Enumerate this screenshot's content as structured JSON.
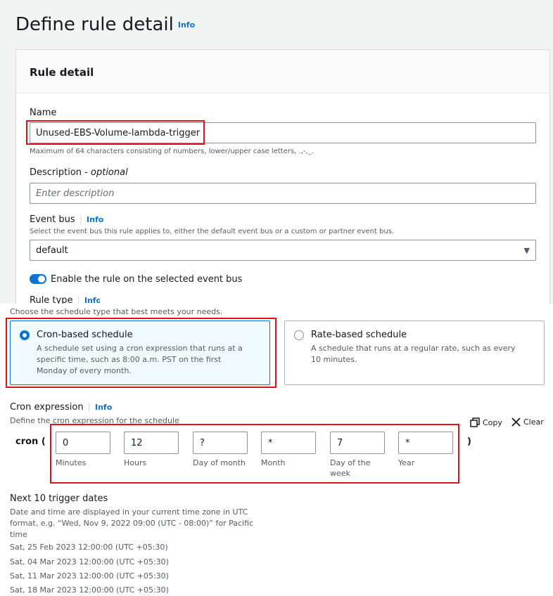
{
  "page": {
    "title": "Define rule detail",
    "info_label": "Info"
  },
  "rule_detail": {
    "section_title": "Rule detail",
    "name": {
      "label": "Name",
      "value": "Unused-EBS-Volume-lambda-trigger",
      "hint": "Maximum of 64 characters consisting of numbers, lower/upper case letters, .,-,_."
    },
    "description": {
      "label": "Description",
      "optional": "optional",
      "placeholder": "Enter description"
    },
    "event_bus": {
      "label": "Event bus",
      "info": "Info",
      "hint": "Select the event bus this rule applies to, either the default event bus or a custom or partner event bus.",
      "value": "default"
    },
    "enable_toggle": {
      "label": "Enable the rule on the selected event bus",
      "on": true
    },
    "rule_type": {
      "label": "Rule type",
      "info": "Info"
    }
  },
  "schedule": {
    "hint": "Choose the schedule type that best meets your needs.",
    "options": [
      {
        "title": "Cron-based schedule",
        "description": "A schedule set using a cron expression that runs at a specific time, such as 8:00 a.m. PST on the first Monday of every month.",
        "selected": true
      },
      {
        "title": "Rate-based schedule",
        "description": "A schedule that runs at a regular rate, such as every 10 minutes.",
        "selected": false
      }
    ]
  },
  "cron": {
    "label": "Cron expression",
    "info": "Info",
    "hint": "Define the cron expression for the schedule",
    "prefix": "cron (",
    "suffix": ")",
    "copy_label": "Copy",
    "clear_label": "Clear",
    "fields": [
      {
        "value": "0",
        "label": "Minutes"
      },
      {
        "value": "12",
        "label": "Hours"
      },
      {
        "value": "?",
        "label": "Day of month"
      },
      {
        "value": "*",
        "label": "Month"
      },
      {
        "value": "7",
        "label": "Day of the week"
      },
      {
        "value": "*",
        "label": "Year"
      }
    ]
  },
  "trigger_dates": {
    "title": "Next 10 trigger dates",
    "description": "Date and time are displayed in your current time zone in UTC format, e.g. “Wed, Nov 9, 2022 09:00 (UTC - 08:00)” for Pacific time",
    "dates": [
      "Sat, 25 Feb 2023 12:00:00 (UTC +05:30)",
      "Sat, 04 Mar 2023 12:00:00 (UTC +05:30)",
      "Sat, 11 Mar 2023 12:00:00 (UTC +05:30)",
      "Sat, 18 Mar 2023 12:00:00 (UTC +05:30)"
    ]
  },
  "colors": {
    "accent": "#0972d3",
    "highlight": "#d91515",
    "selected_bg": "#f1faff"
  }
}
